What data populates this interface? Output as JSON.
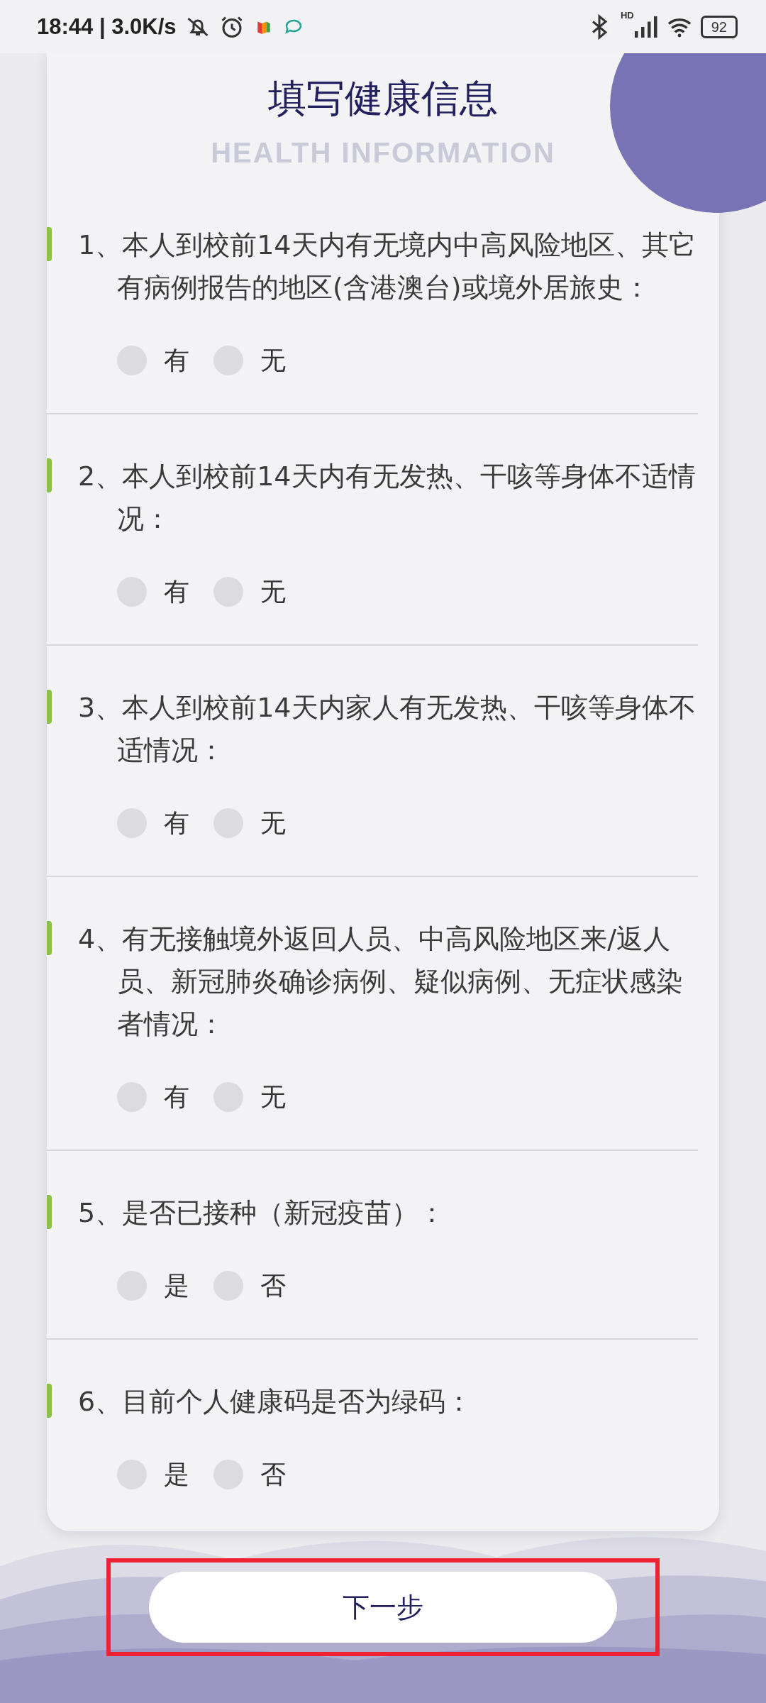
{
  "status_bar": {
    "time_speed": "18:44 | 3.0K/s",
    "network_label": "HD",
    "battery": "92"
  },
  "title": "填写健康信息",
  "subtitle": "HEALTH INFORMATION",
  "questions": [
    {
      "text": "1、本人到校前14天内有无境内中高风险地区、其它有病例报告的地区(含港澳台)或境外居旅史：",
      "options": [
        {
          "label": "有",
          "selected": false
        },
        {
          "label": "无",
          "selected": false
        }
      ]
    },
    {
      "text": "2、本人到校前14天内有无发热、干咳等身体不适情况：",
      "options": [
        {
          "label": "有",
          "selected": false
        },
        {
          "label": "无",
          "selected": false
        }
      ]
    },
    {
      "text": "3、本人到校前14天内家人有无发热、干咳等身体不适情况：",
      "options": [
        {
          "label": "有",
          "selected": false
        },
        {
          "label": "无",
          "selected": false
        }
      ]
    },
    {
      "text": "4、有无接触境外返回人员、中高风险地区来/返人员、新冠肺炎确诊病例、疑似病例、无症状感染者情况：",
      "options": [
        {
          "label": "有",
          "selected": false
        },
        {
          "label": "无",
          "selected": false
        }
      ]
    },
    {
      "text": "5、是否已接种（新冠疫苗）：",
      "options": [
        {
          "label": "是",
          "selected": false
        },
        {
          "label": "否",
          "selected": false
        }
      ]
    },
    {
      "text": "6、目前个人健康码是否为绿码：",
      "options": [
        {
          "label": "是",
          "selected": false
        },
        {
          "label": "否",
          "selected": false
        }
      ]
    }
  ],
  "next_button": {
    "label": "下一步",
    "highlighted": true
  }
}
